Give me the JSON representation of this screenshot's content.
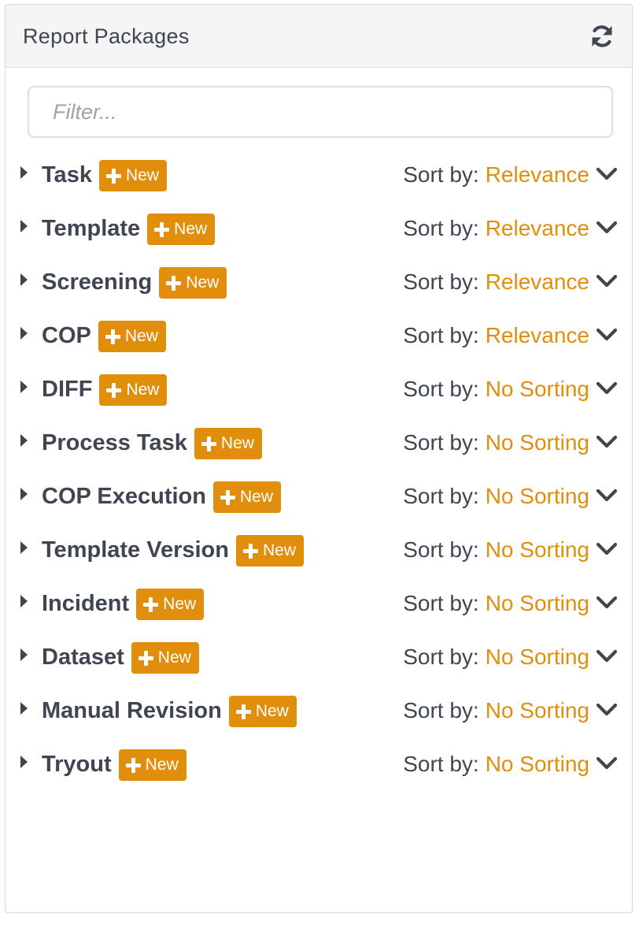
{
  "panel": {
    "title": "Report Packages",
    "refresh_icon": "refresh-icon"
  },
  "filter": {
    "placeholder": "Filter...",
    "value": ""
  },
  "colors": {
    "accent": "#e08e0b",
    "text": "#3f4652"
  },
  "sort_prefix": "Sort by:",
  "new_label": "New",
  "packages": [
    {
      "name": "Task",
      "sort": "Relevance"
    },
    {
      "name": "Template",
      "sort": "Relevance"
    },
    {
      "name": "Screening",
      "sort": "Relevance"
    },
    {
      "name": "COP",
      "sort": "Relevance"
    },
    {
      "name": "DIFF",
      "sort": "No Sorting"
    },
    {
      "name": "Process Task",
      "sort": "No Sorting"
    },
    {
      "name": "COP Execution",
      "sort": "No Sorting"
    },
    {
      "name": "Template Version",
      "sort": "No Sorting"
    },
    {
      "name": "Incident",
      "sort": "No Sorting"
    },
    {
      "name": "Dataset",
      "sort": "No Sorting"
    },
    {
      "name": "Manual Revision",
      "sort": "No Sorting"
    },
    {
      "name": "Tryout",
      "sort": "No Sorting"
    }
  ]
}
